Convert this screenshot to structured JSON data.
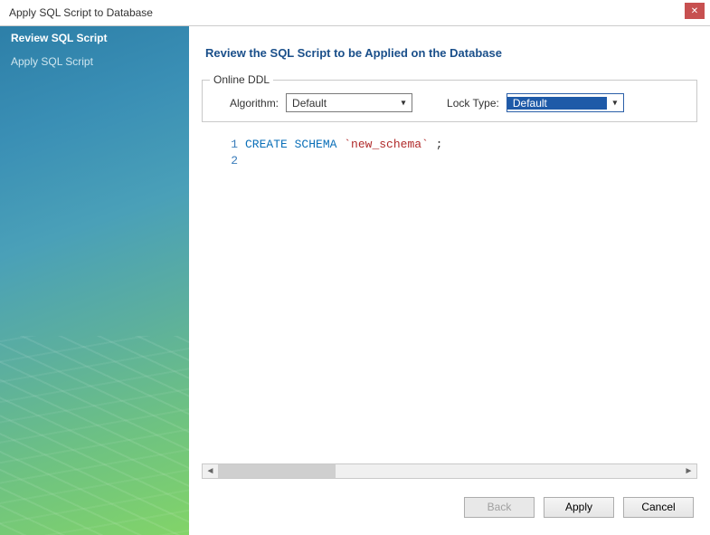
{
  "title": "Apply SQL Script to Database",
  "sidebar": {
    "steps": [
      {
        "label": "Review SQL Script",
        "active": true
      },
      {
        "label": "Apply SQL Script",
        "active": false
      }
    ]
  },
  "heading": "Review the SQL Script to be Applied on the Database",
  "ddl": {
    "group_label": "Online DDL",
    "algorithm_label": "Algorithm:",
    "algorithm_value": "Default",
    "locktype_label": "Lock Type:",
    "locktype_value": "Default"
  },
  "sql": {
    "lines": [
      {
        "n": "1",
        "keyword": "CREATE SCHEMA",
        "identifier": "`new_schema`",
        "suffix": " ;"
      },
      {
        "n": "2",
        "keyword": "",
        "identifier": "",
        "suffix": ""
      }
    ]
  },
  "scroll": {
    "left_arrow": "◄",
    "right_arrow": "►"
  },
  "buttons": {
    "back": "Back",
    "apply": "Apply",
    "cancel": "Cancel"
  },
  "close_glyph": "✕"
}
